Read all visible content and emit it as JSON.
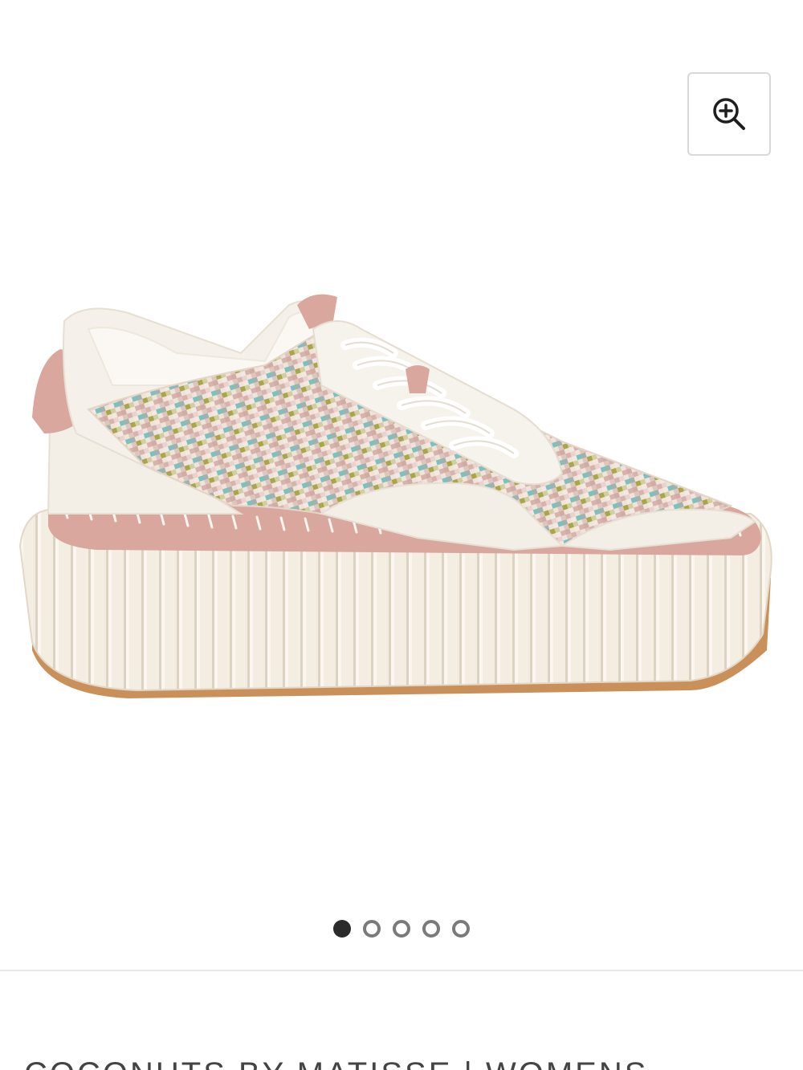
{
  "gallery": {
    "image_alt": "Woven platform sneaker with pink trim and cream ridged sole",
    "zoom": {
      "icon": "zoom-in-icon"
    },
    "dots": {
      "count": 5,
      "active_index": 0
    }
  },
  "product": {
    "brand_line": "COCONUTS BY MATISSE | WOMENS"
  },
  "colors": {
    "sole": "#f3ece0",
    "trim": "#d9a79d",
    "upper": "#f5f1ea",
    "weave_teal": "#7cc1bd",
    "weave_olive": "#a8a646",
    "weave_pink": "#d8b2ac",
    "outsole": "#c9905a"
  }
}
